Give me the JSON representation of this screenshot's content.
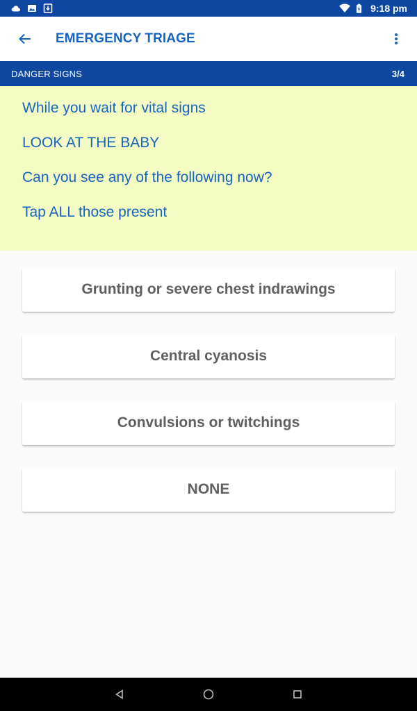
{
  "status_bar": {
    "time": "9:18 pm",
    "icons_left": [
      "cloud-icon",
      "image-icon",
      "download-icon"
    ],
    "icons_right": [
      "wifi-icon",
      "battery-charging-icon"
    ]
  },
  "app_bar": {
    "title": "EMERGENCY TRIAGE"
  },
  "section": {
    "title": "DANGER SIGNS",
    "progress": "3/4"
  },
  "prompt": {
    "lines": [
      "While you wait for vital signs",
      "LOOK AT THE BABY",
      "Can you see any of the following now?",
      "Tap ALL those present"
    ]
  },
  "options": [
    "Grunting or severe chest indrawings",
    "Central cyanosis",
    "Convulsions or twitchings",
    "NONE"
  ],
  "colors": {
    "primary_dark": "#0d47a1",
    "primary": "#1565c0",
    "prompt_background": "#f4fcc4"
  }
}
